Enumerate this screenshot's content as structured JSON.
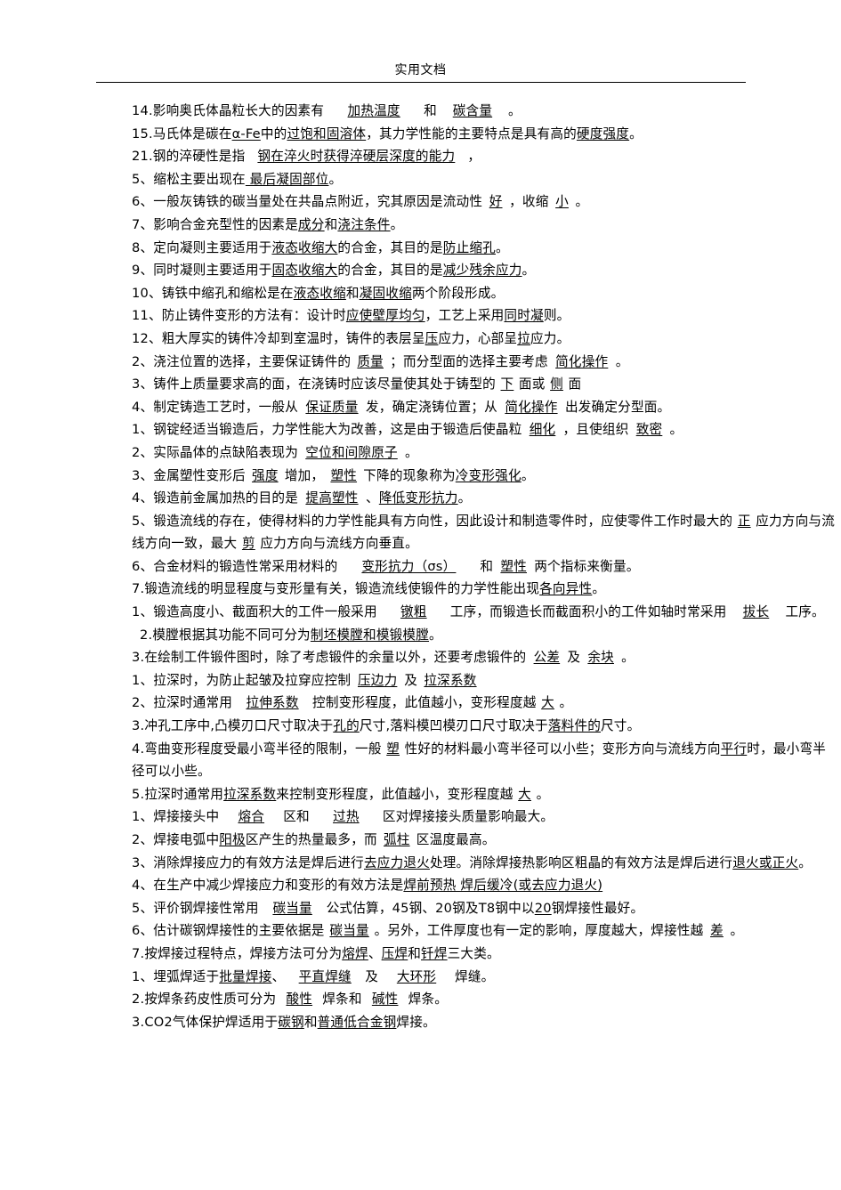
{
  "header": {
    "title": "实用文档"
  },
  "document": {
    "lines": [
      "14.影响奥氏体晶粒长大的因素有 ______加热温度___ 和 ___碳含量___ 。",
      "15.马氏体是碳在α-Fe中的过饱和固溶体，其力学性能的主要特点是具有高的硬度强度。",
      "21.钢的淬硬性是指 ____钢在淬火时获得淬硬层深度的能力____ ，",
      "5、缩松主要出现在 最后凝固部位。",
      "6、一般灰铸铁的碳当量处在共晶点附近，究其原因是流动性 好 ，收缩 小 。",
      "7、影响合金充型性的因素是成分和浇注条件。",
      "8、定向凝则主要适用于液态收缩大的合金，其目的是防止缩孔。",
      "9、同时凝则主要适用于固态收缩大的合金，其目的是减少残余应力。",
      "10、铸铁中缩孔和缩松是在液态收缩和凝固收缩两个阶段形成。",
      "11、防止铸件变形的方法有：设计时应使壁厚均匀，工艺上采用同时凝则。",
      "12、粗大厚实的铸件冷却到室温时，铸件的表层呈压应力，心部呈拉应力。",
      "2、浇注位置的选择，主要保证铸件的质量 ；而分型面的选择主要考虑 简化操作。",
      "3、铸件上质量要求高的面，在浇铸时应该尽量使其处于铸型的 下 面或侧 面",
      "4、制定铸造工艺时，一般从 保证质量 发，确定浇铸位置；从 简化操作 出发确定分型面。",
      "1、钢锭经适当锻造后，力学性能大为改善，这是由于锻造后使晶粒 细化 ，且使组织 致密 。",
      "2、实际晶体的点缺陷表现为 空位和间隙原子 。",
      "3、金属塑性变形后 强度 增加，塑性 下降的现象称为冷变形强化。",
      "4、锻造前金属加热的目的是 提高塑性 、降低变形抗力。",
      "5、锻造流线的存在，使得材料的力学性能具有方向性，因此设计和制造零件时，应使零件工作时最大的 正 应力方向与流线方向一致，最大 剪 应力方向与流线方向垂直。",
      "6、合金材料的锻造性常采用材料的 变形抗力（σs） 和 塑性 两个指标来衡量。",
      "7.锻造流线的明显程度与变形量有关，锻造流线使锻件的力学性能出现各向异性。",
      "1、锻造高度小、截面积大的工件一般采用 镦粗 工序，而锻造长而截面积小的工件如轴时常采用 拔长 工序。",
      "2.模膛根据其功能不同可分为制坯模膛和模锻模膛。",
      "3.在绘制工件锻件图时，除了考虑锻件的余量以外，还要考虑锻件的公差 及 余块 。",
      "1、拉深时，为防止起皱及拉穿应控制 压边力 及 拉深系数",
      "2、拉深时通常用 拉伸系数 控制变形程度，此值越小，变形程度越 大 。",
      "3.冲孔工序中,凸模刃口尺寸取决于孔的 尺寸,落料模凹模刃口尺寸取决于落料件的 尺寸。",
      "4.弯曲变形程度受最小弯半径的限制，一般 塑 性好的材料最小弯半径可以小些；变形方向与流线方向平行时，最小弯半径可以小些。",
      "5.拉深时通常用拉深系数来控制变形程度，此值越小，变形程度越 大 。",
      "1、焊接接头中 熔合 区和 过热 区对焊接接头质量影响最大。",
      "2、焊接电弧中阳极区产生的热量最多，而 弧柱 区温度最高。",
      "3、消除焊接应力的有效方法是焊后进行去应力退火处理。消除焊接热影响区粗晶的有效方法是焊后进行退火或正火。",
      "4、在生产中减少焊接应力和变形的有效方法是焊前预热 焊后缓冷(或去应力退火)",
      "5、评价钢焊接性常用 碳当量 公式估算，45钢、20钢及T8钢中以20钢焊接性最好。",
      "6、估计碳钢焊接性的主要依据是碳当量 。另外，工件厚度也有一定的影响，厚度越大，焊接性越 差 。",
      "7.按焊接过程特点，焊接方法可分为熔焊、压焊和钎焊三大类。",
      "1、埋弧焊适于批量焊接、 平直焊缝 及 大环形 焊缝。",
      "2.按焊条药皮性质可分为 酸性 焊条和 碱性 焊条。",
      "3.CO2气体保护焊适用于碳钢和普通低合金钢焊接。"
    ]
  }
}
